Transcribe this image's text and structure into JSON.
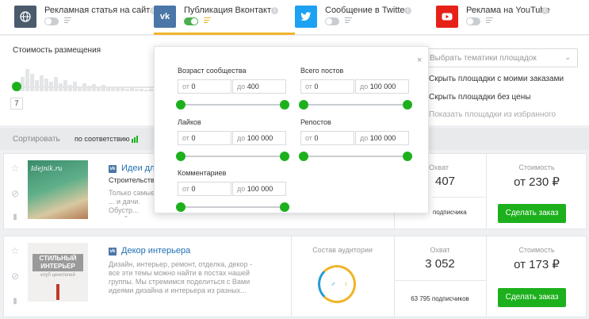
{
  "tabs": [
    {
      "label": "Рекламная статья на сайте",
      "icon": "globe-icon",
      "icon_color": "#4a5b6c",
      "enabled": false
    },
    {
      "label": "Публикация Вконтакте",
      "icon": "vk-icon",
      "icon_color": "#4a76a8",
      "enabled": true
    },
    {
      "label": "Сообщение в Twitter",
      "icon": "twitter-icon",
      "icon_color": "#1da1f2",
      "enabled": false
    },
    {
      "label": "Реклама на YouTube",
      "icon": "youtube-icon",
      "icon_color": "#e62117",
      "enabled": false
    }
  ],
  "vk_icon_text": "vk",
  "filters": {
    "cost_title": "Стоимость размещения",
    "min_value": "7",
    "theme_placeholder": "Выбрать тематики площадок",
    "options": [
      "Скрыть площадки с моими заказами",
      "Скрыть площадки без цены",
      "Показать площадки из избранного"
    ]
  },
  "sort": {
    "label": "Сортировать",
    "value": "по соответствию"
  },
  "popup": {
    "close": "×",
    "groups": [
      {
        "label": "Возраст сообщества",
        "from_prefix": "от",
        "from_value": "0",
        "to_prefix": "до",
        "to_value": "400"
      },
      {
        "label": "Всего постов",
        "from_prefix": "от",
        "from_value": "0",
        "to_prefix": "до",
        "to_value": "100 000"
      },
      {
        "label": "Лайков",
        "from_prefix": "от",
        "from_value": "0",
        "to_prefix": "до",
        "to_value": "100 000"
      },
      {
        "label": "Репостов",
        "from_prefix": "от",
        "from_value": "0",
        "to_prefix": "до",
        "to_value": "100 000"
      },
      {
        "label": "Комментариев",
        "from_prefix": "от",
        "from_value": "0",
        "to_prefix": "до",
        "to_value": "100 000"
      }
    ]
  },
  "cards": [
    {
      "title": "Идеи дл",
      "category": "Строительство",
      "description": "Только самые ... и дачи. Обустр... дизайн. Креати...",
      "thumb_text": "Idejnik.ru",
      "reach_label": "Охват",
      "reach": "407",
      "subscribers": "подписчика",
      "cost_label": "Стоимость",
      "price": "от 230 ₽",
      "button": "Сделать заказ"
    },
    {
      "title": "Декор интерьера",
      "category": "",
      "description": "Дизайн, интерьер, ремонт, отделка, декор - все эти темы можно найти в постах нашей группы. Мы стремимся поделиться с Вами идеями дизайна и интерьера из разных...",
      "thumb_text": "СТИЛЬНЫЙ ИНТЕРЬЕР",
      "thumb_sub": "клуб ценителей",
      "audience_label": "Состав аудитории",
      "reach_label": "Охват",
      "reach": "3 052",
      "subscribers": "63 795 подписчиков",
      "cost_label": "Стоимость",
      "price": "от 173 ₽",
      "button": "Сделать заказ"
    }
  ]
}
